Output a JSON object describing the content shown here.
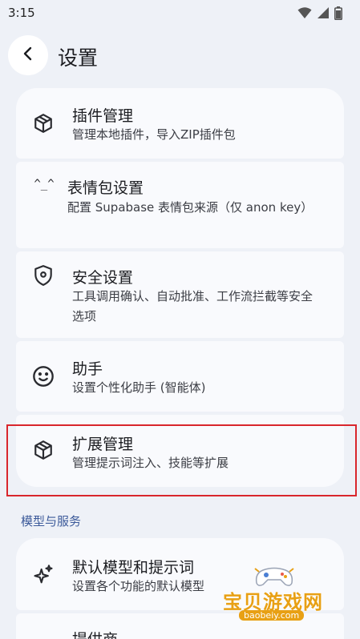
{
  "status_bar": {
    "time": "3:15",
    "icons": [
      "wifi-icon",
      "signal-icon",
      "battery-icon"
    ]
  },
  "header": {
    "back_icon": "chevron-left-icon",
    "title": "设置"
  },
  "items": [
    {
      "id": "plugins",
      "icon": "package-icon",
      "title": "插件管理",
      "subtitle": "管理本地插件，导入ZIP插件包"
    },
    {
      "id": "stickers",
      "icon_text": "^_^",
      "title": "表情包设置",
      "subtitle": "配置 Supabase 表情包来源（仅 anon key）"
    },
    {
      "id": "security",
      "icon": "shield-icon",
      "title": "安全设置",
      "subtitle": "工具调用确认、自动批准、工作流拦截等安全选项"
    },
    {
      "id": "assistant",
      "icon": "smiley-icon",
      "title": "助手",
      "subtitle": "设置个性化助手 (智能体)"
    },
    {
      "id": "extensions",
      "icon": "package-icon",
      "title": "扩展管理",
      "subtitle": "管理提示词注入、技能等扩展"
    }
  ],
  "section_models": {
    "label": "模型与服务",
    "items": [
      {
        "id": "default-model",
        "icon": "sparkle-icon",
        "title": "默认模型和提示词",
        "subtitle": "设置各个功能的默认模型"
      },
      {
        "id": "providers",
        "title": "提供商"
      }
    ]
  },
  "watermark": {
    "text": "宝贝游戏网",
    "url": "baobeiy.com"
  },
  "colors": {
    "background": "#eef1f7",
    "card": "#f9fafd",
    "section_label": "#3c5a9a",
    "highlight": "#d9262c",
    "watermark": "#e8a014"
  }
}
